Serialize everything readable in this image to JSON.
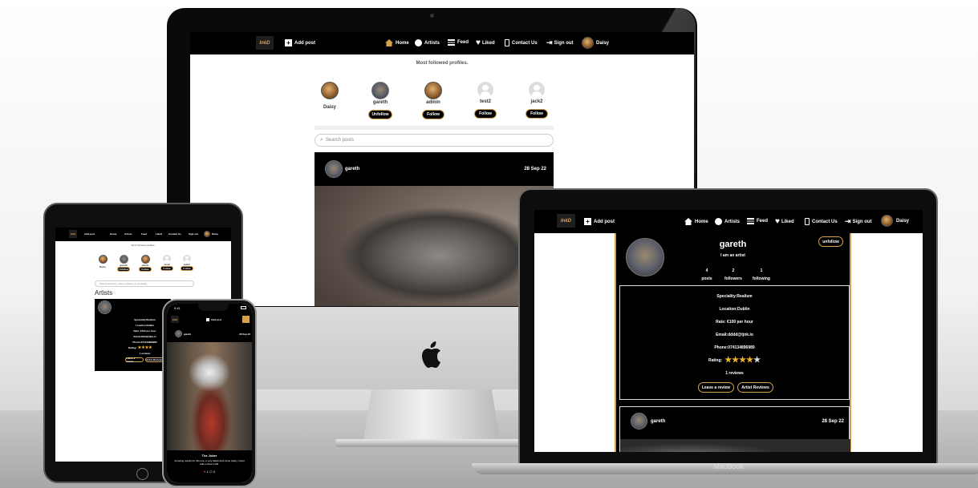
{
  "nav": {
    "logo": "InkD",
    "add_post": "Add post",
    "home": "Home",
    "artists": "Artists",
    "feed": "Feed",
    "liked": "Liked",
    "contact": "Contact Us",
    "signout": "Sign out",
    "user": "Daisy"
  },
  "imac": {
    "section_title": "Most followed profiles.",
    "profiles": [
      {
        "name": "Daisy",
        "button": ""
      },
      {
        "name": "gareth",
        "button": "Unfollow"
      },
      {
        "name": "admin",
        "button": "Follow"
      },
      {
        "name": "test2",
        "button": "Follow"
      },
      {
        "name": "jack2",
        "button": "Follow"
      }
    ],
    "search_placeholder": "Search posts",
    "post": {
      "author": "gareth",
      "date": "28 Sep 22"
    }
  },
  "macbook": {
    "profile": {
      "name": "gareth",
      "bio": "I am an artist",
      "unfollow": "unfollow",
      "posts_count": "4",
      "posts_label": "posts",
      "followers_count": "2",
      "followers_label": "followers",
      "following_count": "1",
      "following_label": "following"
    },
    "details": {
      "speciality": "Speciality:Realism",
      "location": "Location:Dublin",
      "rate": "Rate: €100 per hour",
      "email": "Email:dddd@tjnk.io",
      "phone": "Phone:074134896989",
      "rating_label": "Rating:",
      "rating_value": 4,
      "reviews": "1 reviews",
      "leave_review": "Leave a review",
      "artist_reviews": "Artist Reviews"
    },
    "post": {
      "author": "gareth",
      "date": "28 Sep 22"
    },
    "brand": "MacBook"
  },
  "ipad": {
    "section_title": "Most followed profiles.",
    "search_placeholder": "Search artists by name, location or speciality",
    "artists_heading": "Artists",
    "profiles": [
      {
        "name": "Daisy",
        "button": ""
      },
      {
        "name": "gareth",
        "button": "Unfollow"
      },
      {
        "name": "admin",
        "button": "Follow"
      },
      {
        "name": "test2",
        "button": "Follow"
      },
      {
        "name": "jack2",
        "button": "Follow"
      }
    ],
    "card": {
      "speciality": "Speciality:Realism",
      "location": "Location:Dublin",
      "rate": "Rate: €100 per hour",
      "email": "Email:dddd@tjnk.io",
      "phone": "Phone:074134896989",
      "rating_label": "Rating:",
      "reviews": "1 reviews",
      "leave_review": "Leave a review",
      "artist_reviews": "Artist Reviews"
    }
  },
  "iphone": {
    "time": "9:41",
    "add_post": "Add post",
    "post": {
      "author": "gareth",
      "date": "28 Sep 22",
      "title": "The Joker",
      "caption": "Amazing results for this one, a very detail work done today. Could add a show it still.",
      "likes": "1",
      "comments": "3"
    }
  },
  "colors": {
    "accent_gold": "#d4a24c",
    "star": "#f0b429",
    "nav_bg": "#000000"
  }
}
